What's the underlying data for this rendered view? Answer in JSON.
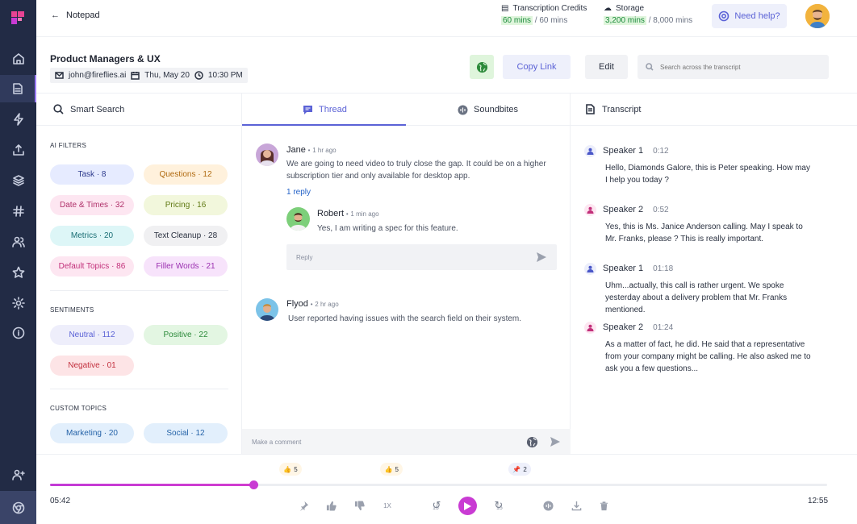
{
  "topbar": {
    "back_label": "Notepad",
    "credits_label": "Transcription Credits",
    "credits_used": "60 mins",
    "credits_total": "/ 60 mins",
    "storage_label": "Storage",
    "storage_used": "3,200 mins",
    "storage_total": "/ 8,000 mins",
    "help_label": "Need help?"
  },
  "meeting": {
    "title": "Product Managers & UX",
    "email": "john@fireflies.ai",
    "date": "Thu, May 20",
    "time": "10:30 PM",
    "copy_link": "Copy Link",
    "edit": "Edit",
    "search_placeholder": "Search across the transcript"
  },
  "smart_search": {
    "header": "Smart Search",
    "ai_filters_title": "AI FILTERS",
    "ai_filters": [
      {
        "label": "Task · 8",
        "bg": "#e6ebff",
        "fg": "#2d3a8c"
      },
      {
        "label": "Questions · 12",
        "bg": "#fff1dc",
        "fg": "#b06a10"
      },
      {
        "label": "Date & Times · 32",
        "bg": "#fde6f1",
        "fg": "#b0306a"
      },
      {
        "label": "Pricing · 16",
        "bg": "#f2f7dc",
        "fg": "#617a14"
      },
      {
        "label": "Metrics · 20",
        "bg": "#ddf6f7",
        "fg": "#1a6e74"
      },
      {
        "label": "Text Cleanup · 28",
        "bg": "#f0f0f2",
        "fg": "#2a3140"
      },
      {
        "label": "Default Topics · 86",
        "bg": "#fde6f1",
        "fg": "#c2307a"
      },
      {
        "label": "Filler Words · 21",
        "bg": "#f7e3fb",
        "fg": "#9b2fb0"
      }
    ],
    "sentiments_title": "SENTIMENTS",
    "sentiments": [
      {
        "label": "Neutral · 112",
        "bg": "#eeeefb",
        "fg": "#5b62d6"
      },
      {
        "label": "Positive · 22",
        "bg": "#e3f6e2",
        "fg": "#2c8a3a"
      },
      {
        "label": "Negative · 01",
        "bg": "#fde4e6",
        "fg": "#c2303e"
      }
    ],
    "custom_title": "CUSTOM TOPICS",
    "custom": [
      {
        "label": "Marketing · 20",
        "bg": "#e2effc",
        "fg": "#2563a8"
      },
      {
        "label": "Social · 12",
        "bg": "#e2effc",
        "fg": "#2563a8"
      }
    ]
  },
  "thread": {
    "tab_thread": "Thread",
    "tab_soundbites": "Soundbites",
    "comments": [
      {
        "name": "Jane",
        "time": "1 hr ago",
        "text": "We are going to need video to truly close the gap. It could be on a higher subscription tier and only available for desktop app.",
        "replies_label": "1 reply"
      },
      {
        "name": "Robert",
        "time": "1 min ago",
        "text": "Yes, I am writing a spec for this feature."
      },
      {
        "name": "Flyod",
        "time": "2 hr ago",
        "text": "User reported having issues with the search field on their system."
      }
    ],
    "reply_placeholder": "Reply",
    "comment_placeholder": "Make a comment"
  },
  "transcript": {
    "header": "Transcript",
    "entries": [
      {
        "speaker": "Speaker 1",
        "time": "0:12",
        "text": "Hello, Diamonds Galore, this is Peter speaking. How may I help you today ?",
        "color": "#4a57c8"
      },
      {
        "speaker": "Speaker 2",
        "time": "0:52",
        "text": "Yes, this is Ms. Janice Anderson calling. May I speak to Mr. Franks, please ? This is really important.",
        "color": "#c2307a"
      },
      {
        "speaker": "Speaker 1",
        "time": "01:18",
        "text": "Uhm...actually, this call is rather urgent. We spoke yesterday about a delivery problem that Mr. Franks mentioned.",
        "color": "#4a57c8"
      },
      {
        "speaker": "Speaker 2",
        "time": "01:24",
        "text": "As a matter of fact, he did. He said that a representative from your company might be calling. He also asked me to ask you a few questions...",
        "color": "#c2307a"
      }
    ]
  },
  "player": {
    "current": "05:42",
    "total": "12:55",
    "progress": 0.262,
    "speed": "1X",
    "skip_back": "15",
    "skip_fwd": "15",
    "markers": [
      {
        "icon": "thumbs-up",
        "count": "5",
        "pos": 0.316
      },
      {
        "icon": "thumbs-up",
        "count": "5",
        "pos": 0.446
      },
      {
        "icon": "pin",
        "count": "2",
        "pos": 0.611
      }
    ]
  }
}
